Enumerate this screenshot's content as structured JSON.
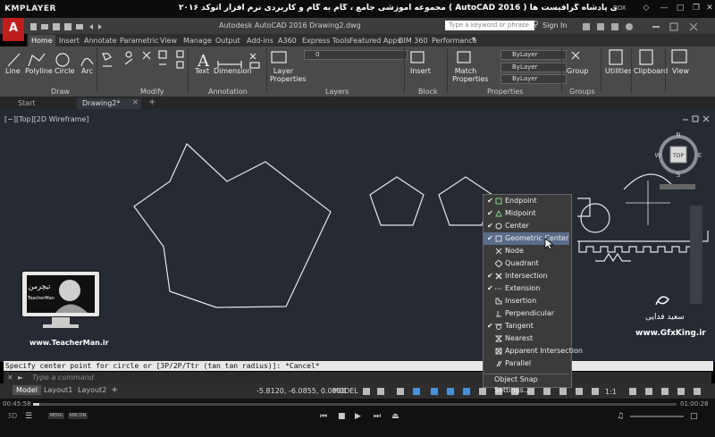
{
  "player": {
    "app_name": "KMPLAYER",
    "video_title": "مجموعه آموزشی جامع ، گام به گام و کاربردی نرم افزار اتوکد ۲۰۱۶ ( AutoCAD 2016 ) مدرس : سعید فدایی (تیچرمن) گروه آموزشی پادشاه گرافیست ها",
    "box_label": "BOX",
    "time_current": "00:45:58",
    "time_total": "01:00:28",
    "progress": 0.01,
    "mini_btn_1": "MENU",
    "mini_btn_2": "KMCON"
  },
  "autocad": {
    "logo_letter": "A",
    "document_title": "Autodesk AutoCAD 2016    Drawing2.dwg",
    "search_placeholder": "Type a keyword or phrase",
    "sign_in": "Sign In",
    "ribbon_tabs": [
      "Home",
      "Insert",
      "Annotate",
      "Parametric",
      "View",
      "Manage",
      "Output",
      "Add-ins",
      "A360",
      "Express Tools",
      "Featured Apps",
      "BIM 360",
      "Performance"
    ],
    "active_tab": "Home",
    "panels": {
      "draw": {
        "title": "Draw",
        "tools": [
          "Line",
          "Polyline",
          "Circle",
          "Arc"
        ]
      },
      "modify": {
        "title": "Modify"
      },
      "annotation": {
        "title": "Annotation",
        "tools": [
          "Text",
          "Dimension"
        ]
      },
      "layers": {
        "title": "Layers",
        "tool": "Layer Properties",
        "layer_value": "0"
      },
      "block": {
        "title": "Block",
        "tool": "Insert"
      },
      "properties": {
        "title": "Properties",
        "tool": "Match Properties",
        "color": "ByLayer",
        "linetype": "ByLayer",
        "lineweight": "ByLayer"
      },
      "groups": {
        "title": "Groups",
        "tool": "Group"
      },
      "utilities": {
        "label": "Utilities"
      },
      "clipboard": {
        "label": "Clipboard"
      },
      "view": {
        "label": "View"
      }
    },
    "file_tabs": [
      "Start",
      "Drawing2*"
    ],
    "active_file": "Drawing2*",
    "viewport_label": "[−][Top][2D Wireframe]",
    "viewcube": {
      "face": "TOP",
      "north": "N",
      "west": "W",
      "east": "E",
      "south": "S"
    },
    "command_history": "Specify center point for circle or [3P/2P/Ttr (tan tan radius)]: *Cancel*",
    "command_placeholder": "Type a command",
    "layout_tabs": [
      "Model",
      "Layout1",
      "Layout2"
    ],
    "active_layout": "Model",
    "coordinates": "-5.8120, -6.0855, 0.0000",
    "model_label": "MODEL",
    "scale": "1:1"
  },
  "snap_menu": {
    "items": [
      {
        "label": "Endpoint",
        "checked": true,
        "icon": "endpoint-square-icon"
      },
      {
        "label": "Midpoint",
        "checked": true,
        "icon": "midpoint-triangle-icon"
      },
      {
        "label": "Center",
        "checked": true,
        "icon": "center-circle-icon"
      },
      {
        "label": "Geometric Center",
        "checked": true,
        "icon": "geometric-center-icon",
        "highlighted": true
      },
      {
        "label": "Node",
        "checked": false,
        "icon": "node-icon"
      },
      {
        "label": "Quadrant",
        "checked": false,
        "icon": "quadrant-icon"
      },
      {
        "label": "Intersection",
        "checked": true,
        "icon": "intersection-icon"
      },
      {
        "label": "Extension",
        "checked": true,
        "icon": "extension-icon"
      },
      {
        "label": "Insertion",
        "checked": false,
        "icon": "insertion-icon"
      },
      {
        "label": "Perpendicular",
        "checked": false,
        "icon": "perpendicular-icon"
      },
      {
        "label": "Tangent",
        "checked": true,
        "icon": "tangent-icon"
      },
      {
        "label": "Nearest",
        "checked": false,
        "icon": "nearest-icon"
      },
      {
        "label": "Apparent Intersection",
        "checked": false,
        "icon": "apparent-intersection-icon"
      },
      {
        "label": "Parallel",
        "checked": false,
        "icon": "parallel-icon"
      }
    ],
    "settings_label": "Object Snap Settings..."
  },
  "watermarks": {
    "teacherman_logo_text": "تیچرمن",
    "teacherman_sub": "TeacherMan",
    "teacherman_url": "www.TeacherMan.ir",
    "author_name": "سعید فدایی",
    "gfxking_url": "www.GfxKing.ir"
  },
  "colors": {
    "drawing_bg": "#252a33",
    "ribbon_bg": "#4a4a4a",
    "autocad_red": "#c01d1d",
    "geometry": "#e6e6e6",
    "menu_highlight": "#5a6c8a"
  }
}
